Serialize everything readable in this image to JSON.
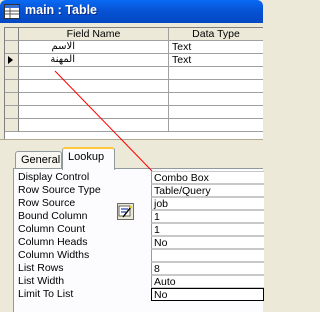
{
  "window": {
    "title": "main : Table",
    "icon": "table-icon"
  },
  "grid": {
    "columns": [
      "Field Name",
      "Data Type"
    ],
    "rows": [
      {
        "field_name": "الاسم",
        "data_type": "Text"
      },
      {
        "field_name": "المهنة",
        "data_type": "Text"
      }
    ]
  },
  "tabs": [
    {
      "label": "General",
      "active": false
    },
    {
      "label": "Lookup",
      "active": true
    }
  ],
  "properties": [
    {
      "label": "Display Control",
      "value": "Combo Box"
    },
    {
      "label": "Row Source Type",
      "value": "Table/Query"
    },
    {
      "label": "Row Source",
      "value": "job"
    },
    {
      "label": "Bound Column",
      "value": "1"
    },
    {
      "label": "Column Count",
      "value": "1"
    },
    {
      "label": "Column Heads",
      "value": "No"
    },
    {
      "label": "Column Widths",
      "value": ""
    },
    {
      "label": "List Rows",
      "value": "8"
    },
    {
      "label": "List Width",
      "value": "Auto"
    },
    {
      "label": "Limit To List",
      "value": "No"
    }
  ],
  "colors": {
    "titlebar": "#0653d5",
    "leader_line": "#ff0000",
    "active_tab_accent": "#ffc83c"
  },
  "icons": {
    "builder_button": "builder-wand-icon",
    "current_row": "row-pointer-icon"
  }
}
